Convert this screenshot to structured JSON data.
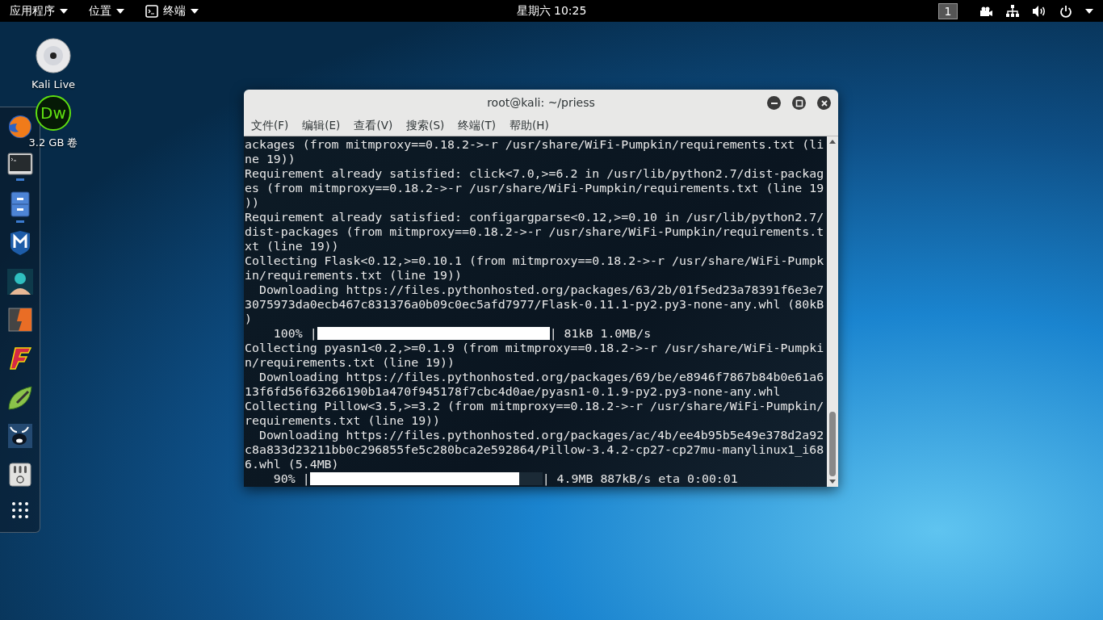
{
  "top_bar": {
    "menus": [
      {
        "label": "应用程序",
        "kind": "plain"
      },
      {
        "label": "位置",
        "kind": "plain"
      },
      {
        "label": "终端",
        "kind": "terminal"
      }
    ],
    "clock": "星期六 10:25",
    "workspace": "1"
  },
  "desktop_icons": [
    {
      "label": "Kali Live",
      "kind": "disc"
    },
    {
      "label": "3.2 GB 卷",
      "kind": "dw",
      "logo_text": "Dw"
    }
  ],
  "dock": [
    {
      "kind": "fox",
      "running": false
    },
    {
      "kind": "terminal",
      "running": true
    },
    {
      "kind": "cabinet",
      "running": true
    },
    {
      "kind": "shield",
      "running": false
    },
    {
      "kind": "avatar",
      "running": false
    },
    {
      "kind": "bolt",
      "running": false
    },
    {
      "kind": "flash",
      "running": false
    },
    {
      "kind": "leaf",
      "running": false
    },
    {
      "kind": "bull",
      "running": false
    },
    {
      "kind": "mixer",
      "running": false
    },
    {
      "kind": "grid",
      "running": false
    }
  ],
  "window": {
    "title": "root@kali: ~/priess",
    "menu": [
      "文件(F)",
      "编辑(E)",
      "查看(V)",
      "搜索(S)",
      "终端(T)",
      "帮助(H)"
    ],
    "lines": [
      {
        "kind": "text",
        "text": "ackages (from mitmproxy==0.18.2->-r /usr/share/WiFi-Pumpkin/requirements.txt (li"
      },
      {
        "kind": "text",
        "text": "ne 19))"
      },
      {
        "kind": "text",
        "text": "Requirement already satisfied: click<7.0,>=6.2 in /usr/lib/python2.7/dist-packag"
      },
      {
        "kind": "text",
        "text": "es (from mitmproxy==0.18.2->-r /usr/share/WiFi-Pumpkin/requirements.txt (line 19"
      },
      {
        "kind": "text",
        "text": "))"
      },
      {
        "kind": "text",
        "text": "Requirement already satisfied: configargparse<0.12,>=0.10 in /usr/lib/python2.7/"
      },
      {
        "kind": "text",
        "text": "dist-packages (from mitmproxy==0.18.2->-r /usr/share/WiFi-Pumpkin/requirements.t"
      },
      {
        "kind": "text",
        "text": "xt (line 19))"
      },
      {
        "kind": "text",
        "text": "Collecting Flask<0.12,>=0.10.1 (from mitmproxy==0.18.2->-r /usr/share/WiFi-Pumpk"
      },
      {
        "kind": "text",
        "text": "in/requirements.txt (line 19))"
      },
      {
        "kind": "text",
        "text": "  Downloading https://files.pythonhosted.org/packages/63/2b/01f5ed23a78391f6e3e7"
      },
      {
        "kind": "text",
        "text": "3075973da0ecb467c831376a0b09c0ec5afd7977/Flask-0.11.1-py2.py3-none-any.whl (80kB"
      },
      {
        "kind": "text",
        "text": ")"
      },
      {
        "kind": "progress",
        "prefix": "    100% |",
        "level": 1,
        "suffix": "| 81kB 1.0MB/s"
      },
      {
        "kind": "text",
        "text": "Collecting pyasn1<0.2,>=0.1.9 (from mitmproxy==0.18.2->-r /usr/share/WiFi-Pumpki"
      },
      {
        "kind": "text",
        "text": "n/requirements.txt (line 19))"
      },
      {
        "kind": "text",
        "text": "  Downloading https://files.pythonhosted.org/packages/69/be/e8946f7867b84b0e61a6"
      },
      {
        "kind": "text",
        "text": "13f6fd56f63266190b1a470f945178f7cbc4d0ae/pyasn1-0.1.9-py2.py3-none-any.whl"
      },
      {
        "kind": "text",
        "text": "Collecting Pillow<3.5,>=3.2 (from mitmproxy==0.18.2->-r /usr/share/WiFi-Pumpkin/"
      },
      {
        "kind": "text",
        "text": "requirements.txt (line 19))"
      },
      {
        "kind": "text",
        "text": "  Downloading https://files.pythonhosted.org/packages/ac/4b/ee4b95b5e49e378d2a92"
      },
      {
        "kind": "text",
        "text": "c8a833d23211bb0c296855fe5c280bca2e592864/Pillow-3.4.2-cp27-cp27mu-manylinux1_i68"
      },
      {
        "kind": "text",
        "text": "6.whl (5.4MB)"
      },
      {
        "kind": "progress",
        "prefix": "    90% |",
        "level": 0.9,
        "suffix": "| 4.9MB 887kB/s eta 0:00:01"
      }
    ]
  }
}
